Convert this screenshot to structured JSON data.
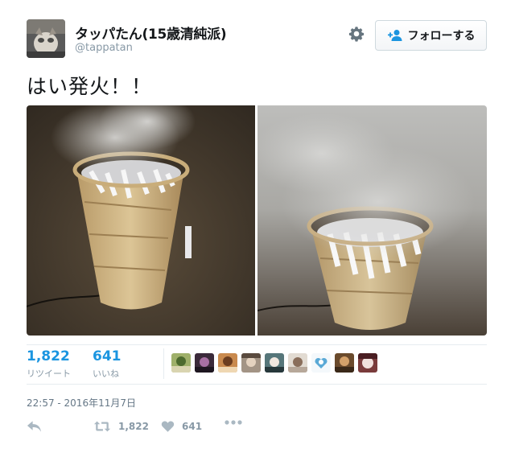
{
  "user": {
    "display_name": "タッパたん(15歳清純派)",
    "handle": "@tappatan"
  },
  "follow_button": {
    "label": "フォローする",
    "icon": "follow-person-icon"
  },
  "settings": {
    "icon": "gear-icon"
  },
  "tweet": {
    "text": "はい発火！！"
  },
  "stats": {
    "retweets": {
      "count": "1,822",
      "label": "リツイート"
    },
    "likes": {
      "count": "641",
      "label": "いいね"
    }
  },
  "likers_count_shown": 9,
  "timestamp": "22:57 - 2016年11月7日",
  "actions": {
    "reply": {
      "icon": "reply-icon"
    },
    "retweet": {
      "icon": "retweet-icon",
      "count": "1,822"
    },
    "like": {
      "icon": "heart-icon",
      "count": "641"
    },
    "more": {
      "icon": "more-dots-icon"
    }
  },
  "colors": {
    "accent": "#1b95e0",
    "muted": "#8899a6",
    "text": "#14171a",
    "border": "#e6ecf0"
  }
}
